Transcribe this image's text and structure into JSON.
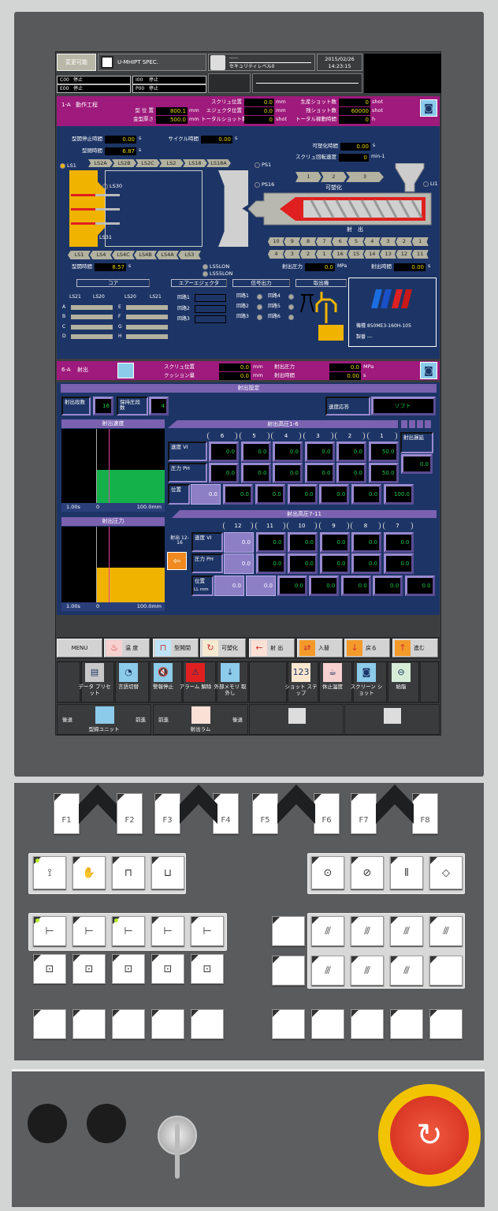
{
  "header": {
    "mode": "変更可能",
    "file": "U-MHIPT SPEC.",
    "user": "-----",
    "security": "セキュリティレベル0",
    "date": "2015/02/26",
    "time": "14:23:15",
    "status": [
      {
        "code": "C00",
        "state": "停止"
      },
      {
        "code": "I00",
        "state": "停止"
      },
      {
        "code": "E00",
        "state": "停止"
      },
      {
        "code": "P00",
        "state": "停止"
      }
    ]
  },
  "process": {
    "step": "1-A",
    "name": "動作工程",
    "fields": [
      {
        "label": "型 位 置",
        "value": "800.1",
        "unit": "mm"
      },
      {
        "label": "金型厚さ",
        "value": "500.0",
        "unit": "mm"
      },
      {
        "label": "スクリュ位置",
        "value": "0.0",
        "unit": "mm"
      },
      {
        "label": "エジェクタ位置",
        "value": "0.0",
        "unit": "mm"
      },
      {
        "label": "トータルショット数",
        "value": "0",
        "unit": "shot"
      },
      {
        "label": "生産ショット数",
        "value": "0",
        "unit": "shot"
      },
      {
        "label": "残ショット数",
        "value": "60000",
        "unit": "shot"
      },
      {
        "label": "トータル稼動時間",
        "value": "0",
        "unit": "h"
      }
    ]
  },
  "machine": {
    "timers": [
      {
        "label": "型開停止時間",
        "value": "0.00",
        "unit": "s"
      },
      {
        "label": "型閉時間",
        "value": "6.87",
        "unit": "s"
      },
      {
        "label": "サイクル時間",
        "value": "0.00",
        "unit": "s"
      },
      {
        "label": "可塑化時間",
        "value": "0.00",
        "unit": "s"
      },
      {
        "label": "スクリュ回転速度",
        "value": "0",
        "unit": "min-1"
      },
      {
        "label": "型開時間",
        "value": "8.57",
        "unit": "s"
      },
      {
        "label": "射出圧力",
        "value": "0.0",
        "unit": "MPa"
      },
      {
        "label": "射出時間",
        "value": "0.00",
        "unit": "s"
      }
    ],
    "ls_top": [
      "LS2A",
      "LS2B",
      "LS2C",
      "LS2",
      "LS18",
      "LS18A"
    ],
    "ls_bottom": [
      "LS1",
      "LS4",
      "LS4C",
      "LS4B",
      "LS4A",
      "LS3"
    ],
    "sensors": [
      {
        "label": "LS1",
        "color": "#f0b400"
      },
      {
        "label": "LS30",
        "color": "#1d3566"
      },
      {
        "label": "LS31",
        "color": "#e02020"
      },
      {
        "label": "PS1",
        "color": "#1d3566"
      },
      {
        "label": "PS16",
        "color": "#1d3566"
      },
      {
        "label": "LI1",
        "color": "#1d3566"
      },
      {
        "label": "LS5LON",
        "color": "#a8a898"
      },
      {
        "label": "LS55LON",
        "color": "#a8a898"
      }
    ],
    "plasticize_steps": [
      "1",
      "2",
      "3"
    ],
    "plasticize_label": "可塑化",
    "injection_label": "射　出",
    "inject_row1": [
      "10",
      "9",
      "8",
      "7",
      "6",
      "5",
      "4",
      "3",
      "2",
      "1"
    ],
    "inject_row2": [
      "4",
      "3",
      "2",
      "1",
      "16",
      "15",
      "14",
      "13",
      "12",
      "11"
    ],
    "panels": [
      "コア",
      "エアーエジェクタ",
      "信号出力",
      "取出機"
    ],
    "core_headers": [
      "LS21",
      "LS20",
      "LS20",
      "LS21"
    ],
    "core_left": [
      "A",
      "B",
      "C",
      "D"
    ],
    "core_right": [
      "E",
      "F",
      "G",
      "H"
    ],
    "air_circuits": [
      "回路1",
      "回路2",
      "回路3"
    ],
    "signal_circuits": [
      "回路1",
      "回路2",
      "回路3",
      "回路4",
      "回路5",
      "回路6"
    ],
    "model": "機種 850ME3-160H-105",
    "serial": "製番 ---"
  },
  "injection_status": {
    "step": "6-A",
    "name": "射出",
    "fields": [
      {
        "label": "スクリュ位置",
        "value": "0.0",
        "unit": "mm"
      },
      {
        "label": "クッション量",
        "value": "0.0",
        "unit": "mm"
      },
      {
        "label": "射出圧力",
        "value": "0.0",
        "unit": "MPa"
      },
      {
        "label": "射出時間",
        "value": "0.00",
        "unit": "s"
      }
    ]
  },
  "settings": {
    "title": "射出設定",
    "stages_label": "射出段数",
    "stages": "16",
    "hold_label": "保持圧段数",
    "hold": "4",
    "response_label": "速度応答",
    "response": "ソフト",
    "charts": [
      {
        "title": "射出速度",
        "axis": [
          "1.00s",
          "0",
          "100.0mm"
        ],
        "fill_fraction": 0.45,
        "fill_color": "#14b04a"
      },
      {
        "title": "射出圧力",
        "axis": [
          "1.00s",
          "0",
          "100.0mm"
        ],
        "fill_fraction": 0.46,
        "fill_color": "#f0b400"
      }
    ],
    "high1": {
      "title": "射出高圧1-6",
      "stages": [
        "6",
        "5",
        "4",
        "3",
        "2",
        "1"
      ],
      "speed_label": "速度 VI",
      "pressure_label": "圧力 PH",
      "pct": "%",
      "speed": [
        "0.0",
        "0.0",
        "0.0",
        "0.0",
        "0.0",
        "50.0"
      ],
      "pressure": [
        "0.0",
        "0.0",
        "0.0",
        "0.0",
        "0.0",
        "50.0"
      ],
      "position_label": "位置",
      "position_unit": "mm",
      "positions": [
        "0.0",
        "0.0",
        "0.0",
        "0.0",
        "0.0",
        "0.0",
        "100.0"
      ],
      "delay_label": "射出遅延",
      "delay_unit": "s",
      "delay": "0.0"
    },
    "high2": {
      "title": "射出高圧7-11",
      "stages": [
        "12",
        "11",
        "10",
        "9",
        "8",
        "7"
      ],
      "side_label": "射出 12-16",
      "speed_label": "速度 VI",
      "pressure_label": "圧力 PH",
      "pct": "%",
      "speed": [
        "0.0",
        "0.0",
        "0.0",
        "0.0",
        "0.0",
        "0.0"
      ],
      "pressure": [
        "0.0",
        "0.0",
        "0.0",
        "0.0",
        "0.0",
        "0.0"
      ],
      "position_label": "位置",
      "position_unit": "LL mm",
      "positions": [
        "0.0",
        "0.0",
        "0.0",
        "0.0",
        "0.0",
        "0.0",
        "0.0"
      ]
    }
  },
  "menu": {
    "tabs": [
      {
        "label": "MENU",
        "icon": "",
        "color": "#d3d3d3"
      },
      {
        "label": "温 度",
        "icon": "♨",
        "color": "#f7d0d0"
      },
      {
        "label": "型開閉",
        "icon": "⊓",
        "color": "#bfe4f7"
      },
      {
        "label": "可塑化",
        "icon": "↻",
        "color": "#f6ead0"
      },
      {
        "label": "射 出",
        "icon": "←",
        "color": "#fbe0d6"
      },
      {
        "label": "入替",
        "icon": "⇄",
        "color": "#f39a2a"
      },
      {
        "label": "戻る",
        "icon": "↓",
        "color": "#f39a2a"
      },
      {
        "label": "進む",
        "icon": "↑",
        "color": "#f39a2a"
      }
    ],
    "functions": [
      {
        "label": "データ プリセット",
        "icon": "▤",
        "color": "#c8c8c8"
      },
      {
        "label": "言語切替",
        "icon": "◔",
        "color": "#8ccbea"
      },
      {
        "label": "警報停止",
        "icon": "🔇",
        "color": "#8ccbea"
      },
      {
        "label": "アラーム 解除",
        "icon": "⚠",
        "color": "#e02020"
      },
      {
        "label": "外部メモリ 取外し",
        "icon": "↓",
        "color": "#8ccbea"
      },
      {
        "label": "ショット ステップ",
        "icon": "123",
        "color": "#fbe7d0"
      },
      {
        "label": "休止温度",
        "icon": "☕",
        "color": "#f7d0d0"
      },
      {
        "label": "スクリーン ショット",
        "icon": "◙",
        "color": "#8ccbea"
      },
      {
        "label": "給脂",
        "icon": "⊖",
        "color": "#d6ecd6"
      }
    ],
    "units": [
      {
        "left": "後退",
        "label": "型締ユニット",
        "right": "前進",
        "color": "#8ccbea"
      },
      {
        "left": "前進",
        "label": "射出ラム",
        "right": "後退",
        "color": "#fbe0d6"
      }
    ]
  },
  "keypad": {
    "fkeys": [
      "F1",
      "F2",
      "F3",
      "F4",
      "F5",
      "F6",
      "F7",
      "F8"
    ]
  },
  "colors": {
    "magenta": "#9e1a7c",
    "navy": "#1d3566",
    "purple": "#7a62b0",
    "value_yellow": "#e8d800",
    "value_green": "#19c84a"
  }
}
